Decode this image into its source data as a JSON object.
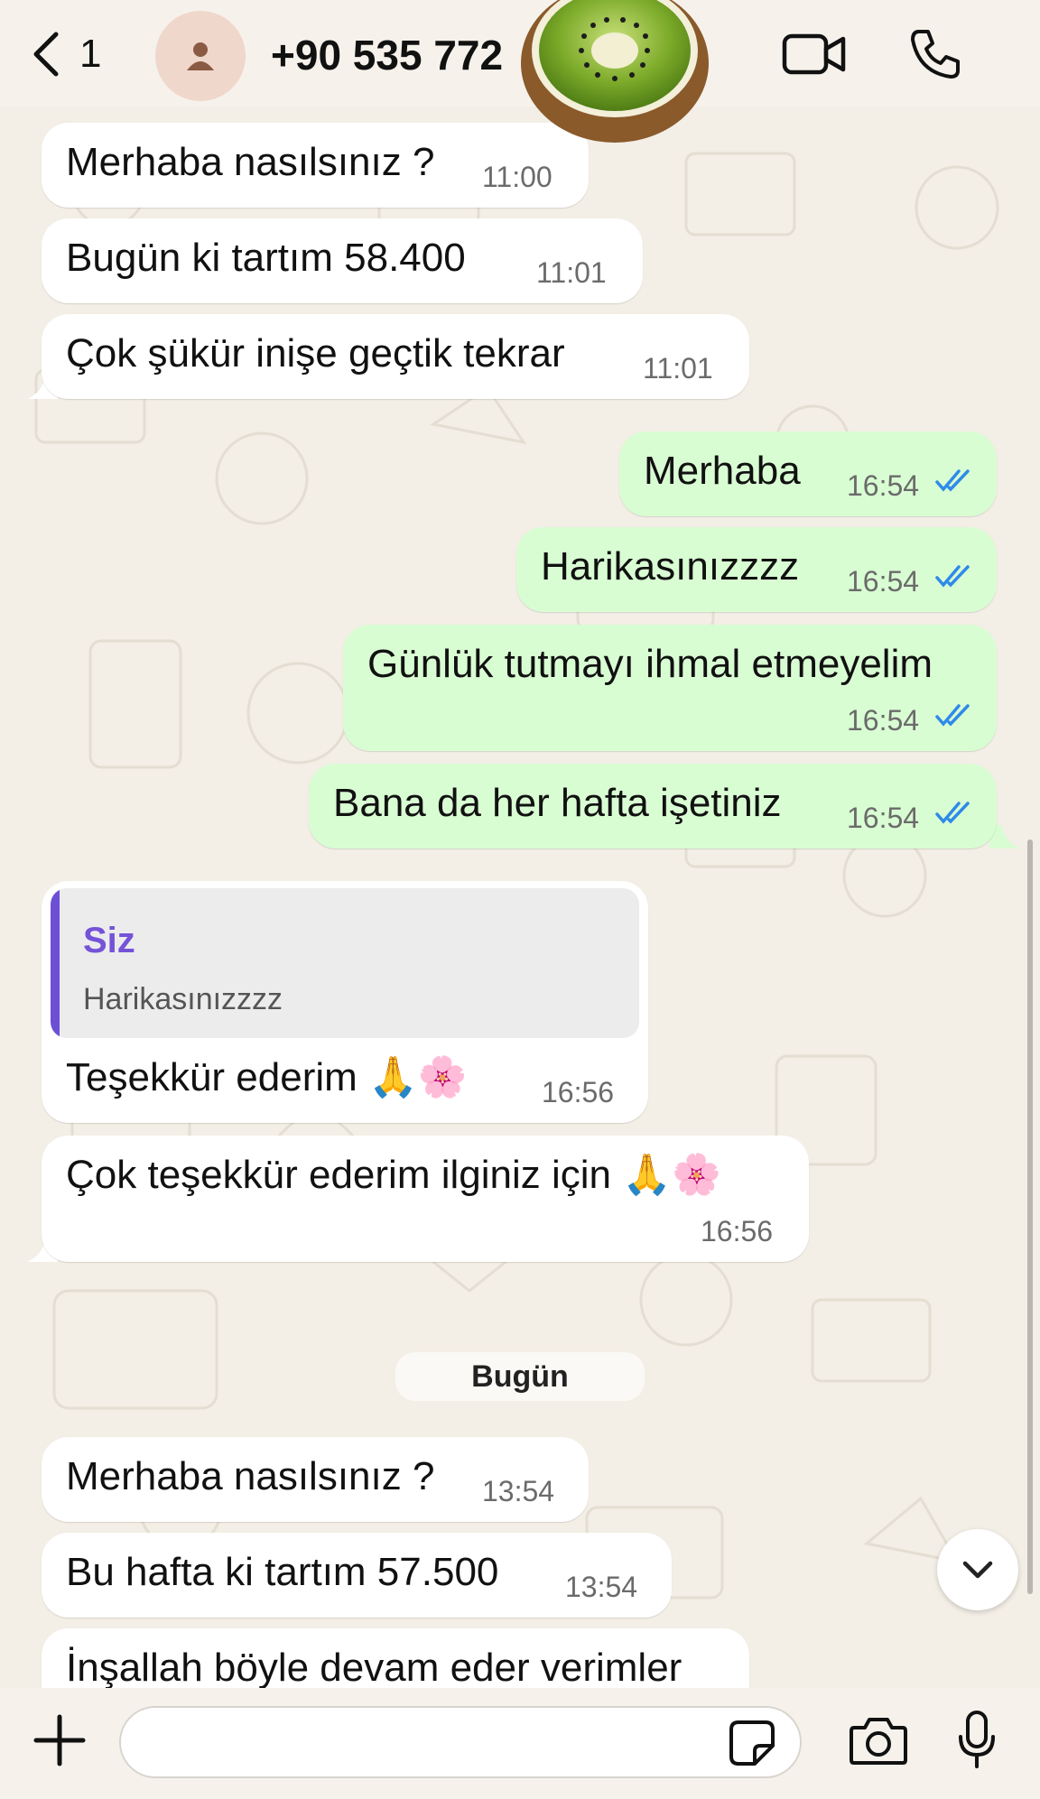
{
  "header": {
    "back_count": "1",
    "contact_name": "+90 535 772"
  },
  "messages": [
    {
      "text": "Merhaba nasılsınız ?",
      "time": "11:00"
    },
    {
      "text": "Bugün ki tartım 58.400",
      "time": "11:01"
    },
    {
      "text": "Çok şükür inişe geçtik tekrar",
      "time": "11:01"
    },
    {
      "text": "Merhaba",
      "time": "16:54"
    },
    {
      "text": "Harikasınızzzz",
      "time": "16:54"
    },
    {
      "text": "Günlük tutmayı ihmal etmeyelim",
      "time": "16:54"
    },
    {
      "text": "Bana da her hafta işetiniz",
      "time": "16:54"
    },
    {
      "quote_author": "Siz",
      "quote_text": "Harikasınızzzz",
      "text": "Teşekkür ederim 🙏🌸",
      "time": "16:56"
    },
    {
      "text": "Çok teşekkür ederim ilginiz için 🙏🌸",
      "time": "16:56"
    },
    {
      "text": "Merhaba nasılsınız ?",
      "time": "13:54"
    },
    {
      "text": "Bu hafta ki tartım 57.500",
      "time": "13:54"
    },
    {
      "text": "İnşallah böyle devam eder verimler"
    }
  ],
  "date_separator": "Bugün",
  "colors": {
    "incoming_bubble": "#ffffff",
    "outgoing_bubble": "#d9fdd3",
    "read_ticks": "#2f8ae8",
    "quote_accent": "#6d4fd6",
    "background": "#f3eee6"
  },
  "composer": {
    "placeholder": ""
  }
}
